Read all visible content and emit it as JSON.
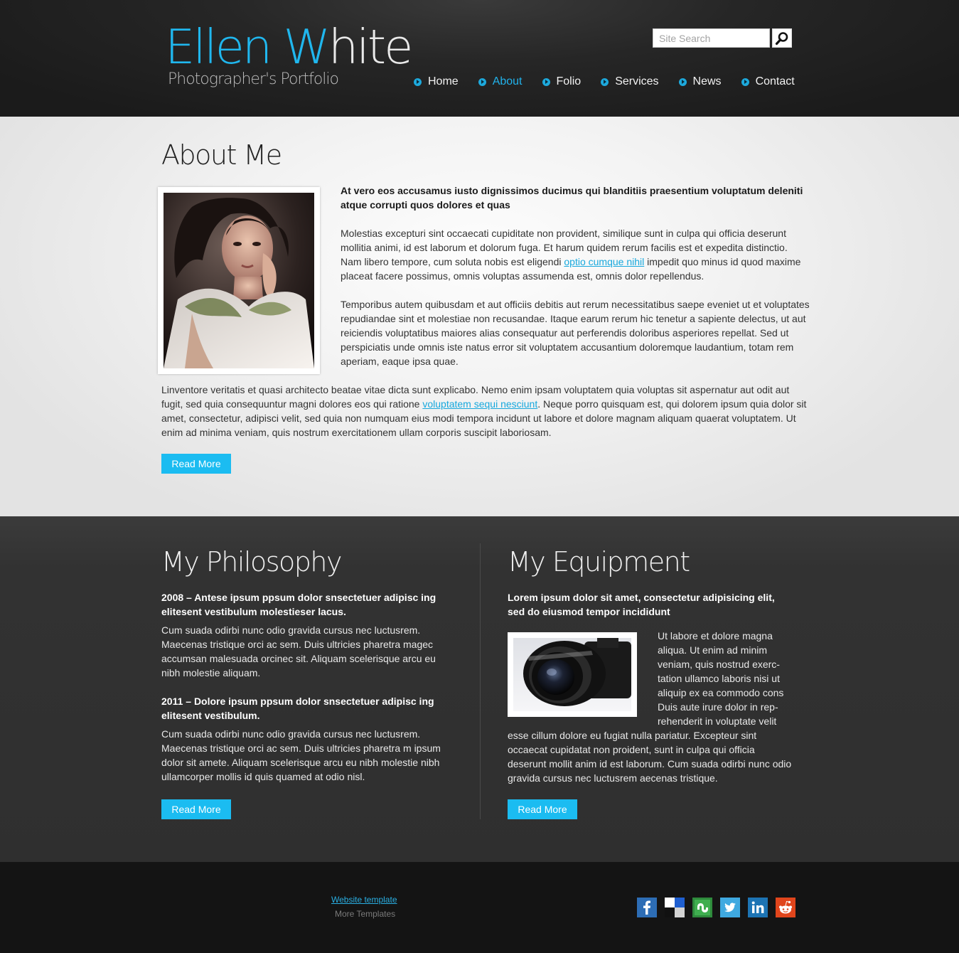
{
  "header": {
    "logo_first": "Ellen",
    "logo_last_w": "W",
    "logo_last_rest": "hite",
    "tagline": "Photographer's Portfolio",
    "search_placeholder": "Site Search",
    "nav": [
      {
        "label": "Home"
      },
      {
        "label": "About",
        "active": true
      },
      {
        "label": "Folio"
      },
      {
        "label": "Services"
      },
      {
        "label": "News"
      },
      {
        "label": "Contact"
      }
    ]
  },
  "about": {
    "title": "About Me",
    "lead": "At vero eos accusamus iusto dignissimos ducimus qui blanditiis praesentium voluptatum deleniti atque corrupti quos dolores et quas",
    "p1_a": "Molestias excepturi sint occaecati cupiditate non provident, similique sunt in culpa qui officia deserunt mollitia animi, id est laborum et dolorum fuga. Et harum quidem rerum facilis est et expedita distinctio. Nam libero tempore, cum soluta nobis est eligendi ",
    "p1_link": "optio cumque nihil",
    "p1_b": " impedit quo minus id quod maxime placeat facere possimus, omnis voluptas assumenda est, omnis dolor repellendus.",
    "p2": "Temporibus autem quibusdam et aut officiis debitis aut rerum necessitatibus saepe eveniet ut et voluptates repudiandae sint et molestiae non recusandae. Itaque earum rerum hic tenetur a sapiente delectus, ut aut reiciendis voluptatibus maiores alias consequatur aut perferendis doloribus asperiores repellat. Sed ut perspiciatis unde omnis iste natus error sit voluptatem accusantium doloremque laudantium, totam rem aperiam, eaque ipsa quae.",
    "p3_a": "Linventore veritatis et quasi architecto beatae vitae dicta sunt explicabo. Nemo enim ipsam voluptatem quia voluptas sit aspernatur aut odit aut fugit, sed quia consequuntur magni dolores eos qui ratione ",
    "p3_link": "voluptatem sequi nesciunt",
    "p3_b": ". Neque porro quisquam est, qui dolorem ipsum quia dolor sit amet, consectetur, adipisci velit, sed quia non numquam eius modi tempora incidunt ut labore et dolore magnam aliquam quaerat voluptatem. Ut enim ad minima veniam, quis nostrum exercitationem ullam corporis suscipit laboriosam.",
    "read_more": "Read More"
  },
  "philosophy": {
    "title": "My Philosophy",
    "lead1": "2008 – Antese ipsum ppsum dolor snsectetuer adipisc ing elitesent vestibulum molestieser lacus.",
    "text1": "Cum suada odirbi nunc odio gravida cursus nec luctusrem. Maecenas tristique orci ac sem. Duis ultricies pharetra magec accumsan malesuada orcinec sit. Aliquam scelerisque arcu eu nibh molestie aliquam.",
    "lead2": "2011 – Dolore ipsum ppsum dolor snsectetuer adipisc ing elitesent vestibulum.",
    "text2": "Cum suada odirbi nunc odio gravida cursus nec luctusrem. Maecenas tristique orci ac sem. Duis ultricies pharetra m ipsum dolor sit amete. Aliquam scelerisque arcu eu nibh molestie nibh ullamcorper mollis id quis quamed at odio nisl.",
    "read_more": "Read More"
  },
  "equipment": {
    "title": "My Equipment",
    "lead": "Lorem ipsum dolor sit amet, consectetur adipisicing elit, sed do eiusmod tempor incididunt",
    "wrap_text": "Ut labore et dolore magna aliqua. Ut enim ad minim veniam, quis nostrud exerc-tation ullamco laboris nisi ut aliquip ex ea commodo cons Duis aute irure dolor in rep-rehenderit in voluptate velit",
    "rest_text": "esse cillum dolore eu fugiat nulla pariatur. Excepteur sint occaecat cupidatat non proident, sunt in culpa qui officia deserunt mollit anim id est laborum. Cum suada odirbi nunc odio gravida cursus nec luctusrem aecenas tristique.",
    "read_more": "Read More"
  },
  "footer": {
    "link": "Website template",
    "more": "More Templates",
    "social": [
      "facebook-icon",
      "delicious-icon",
      "stumbleupon-icon",
      "twitter-icon",
      "linkedin-icon",
      "reddit-icon"
    ]
  },
  "colors": {
    "accent": "#1bbcf1",
    "header_bg": "#1f1f1f",
    "dark_section_bg": "#333333",
    "footer_bg": "#141414"
  }
}
